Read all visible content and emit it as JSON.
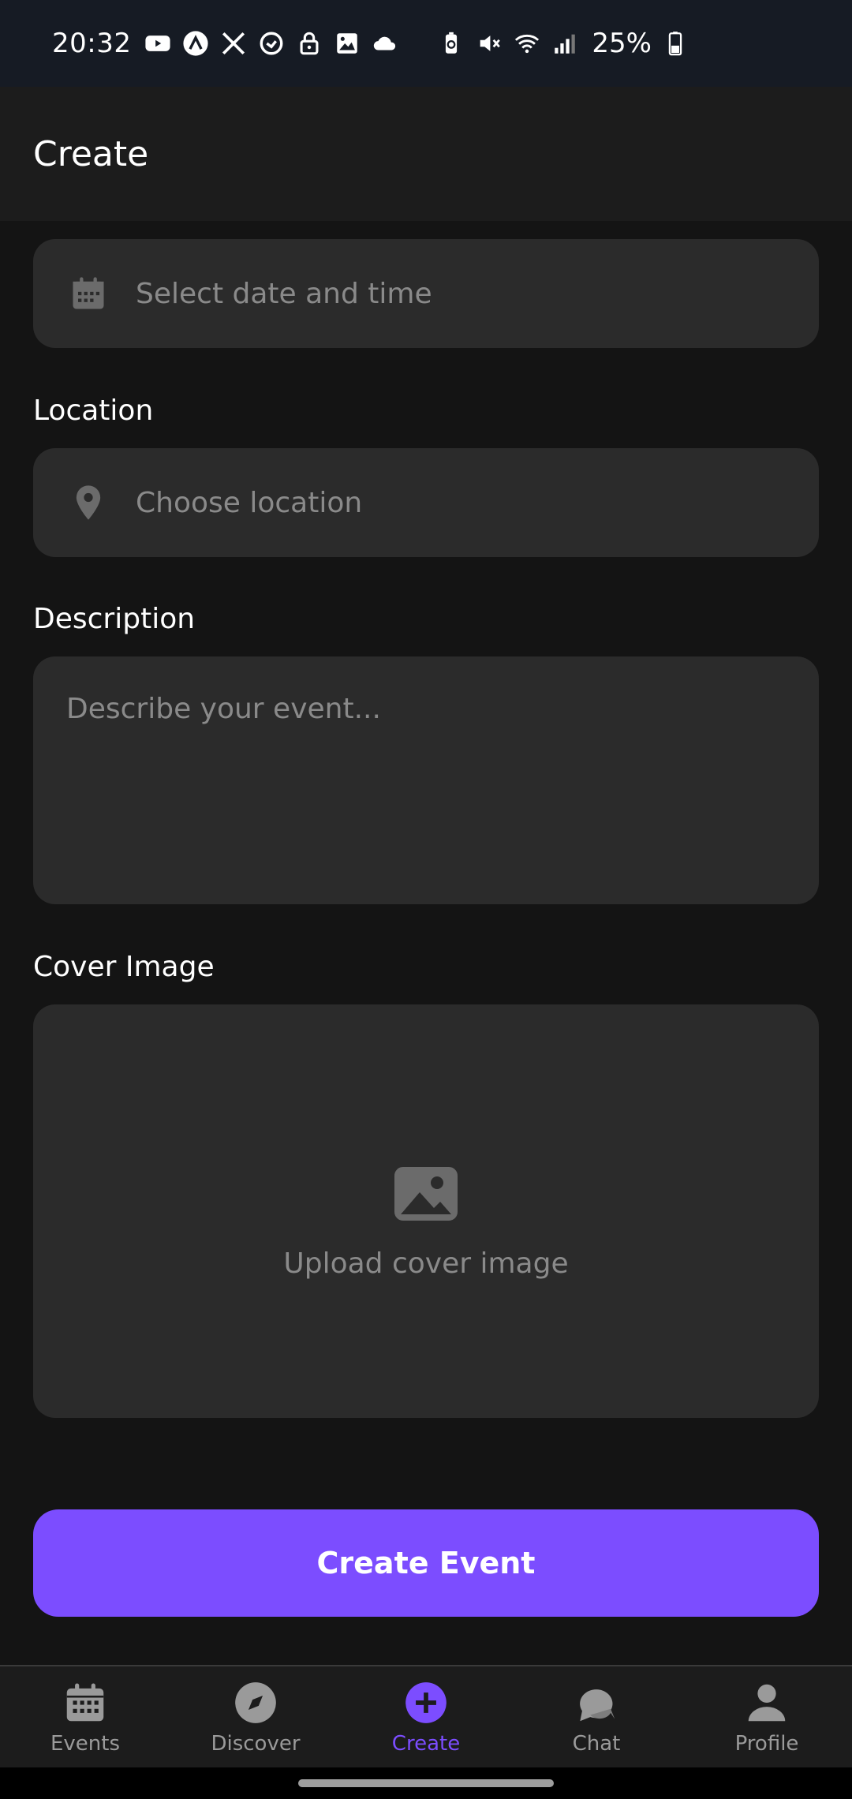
{
  "status_bar": {
    "time": "20:32",
    "battery_percent": "25%",
    "left_icons": [
      "youtube-icon",
      "app-icon",
      "x-icon",
      "sync-icon",
      "lock-icon",
      "gallery-icon",
      "cloud-icon"
    ],
    "right_icons": [
      "battery-saver-icon",
      "mute-icon",
      "wifi-icon",
      "signal-icon",
      "battery-icon"
    ]
  },
  "header": {
    "title": "Create"
  },
  "form": {
    "datetime": {
      "placeholder": "Select date and time",
      "icon": "calendar-icon"
    },
    "location": {
      "label": "Location",
      "placeholder": "Choose location",
      "icon": "location-pin-icon"
    },
    "description": {
      "label": "Description",
      "placeholder": "Describe your event..."
    },
    "cover_image": {
      "label": "Cover Image",
      "upload_text": "Upload cover image",
      "icon": "image-icon"
    },
    "submit_label": "Create Event"
  },
  "nav": {
    "items": [
      {
        "label": "Events",
        "icon": "calendar-icon"
      },
      {
        "label": "Discover",
        "icon": "compass-icon"
      },
      {
        "label": "Create",
        "icon": "plus-circle-icon",
        "active": true
      },
      {
        "label": "Chat",
        "icon": "chat-icon"
      },
      {
        "label": "Profile",
        "icon": "person-icon"
      }
    ]
  },
  "colors": {
    "accent": "#7c4dff",
    "background": "#141414",
    "surface": "#2b2b2b",
    "header": "#1c1c1c",
    "placeholder": "#8a8a8a"
  }
}
